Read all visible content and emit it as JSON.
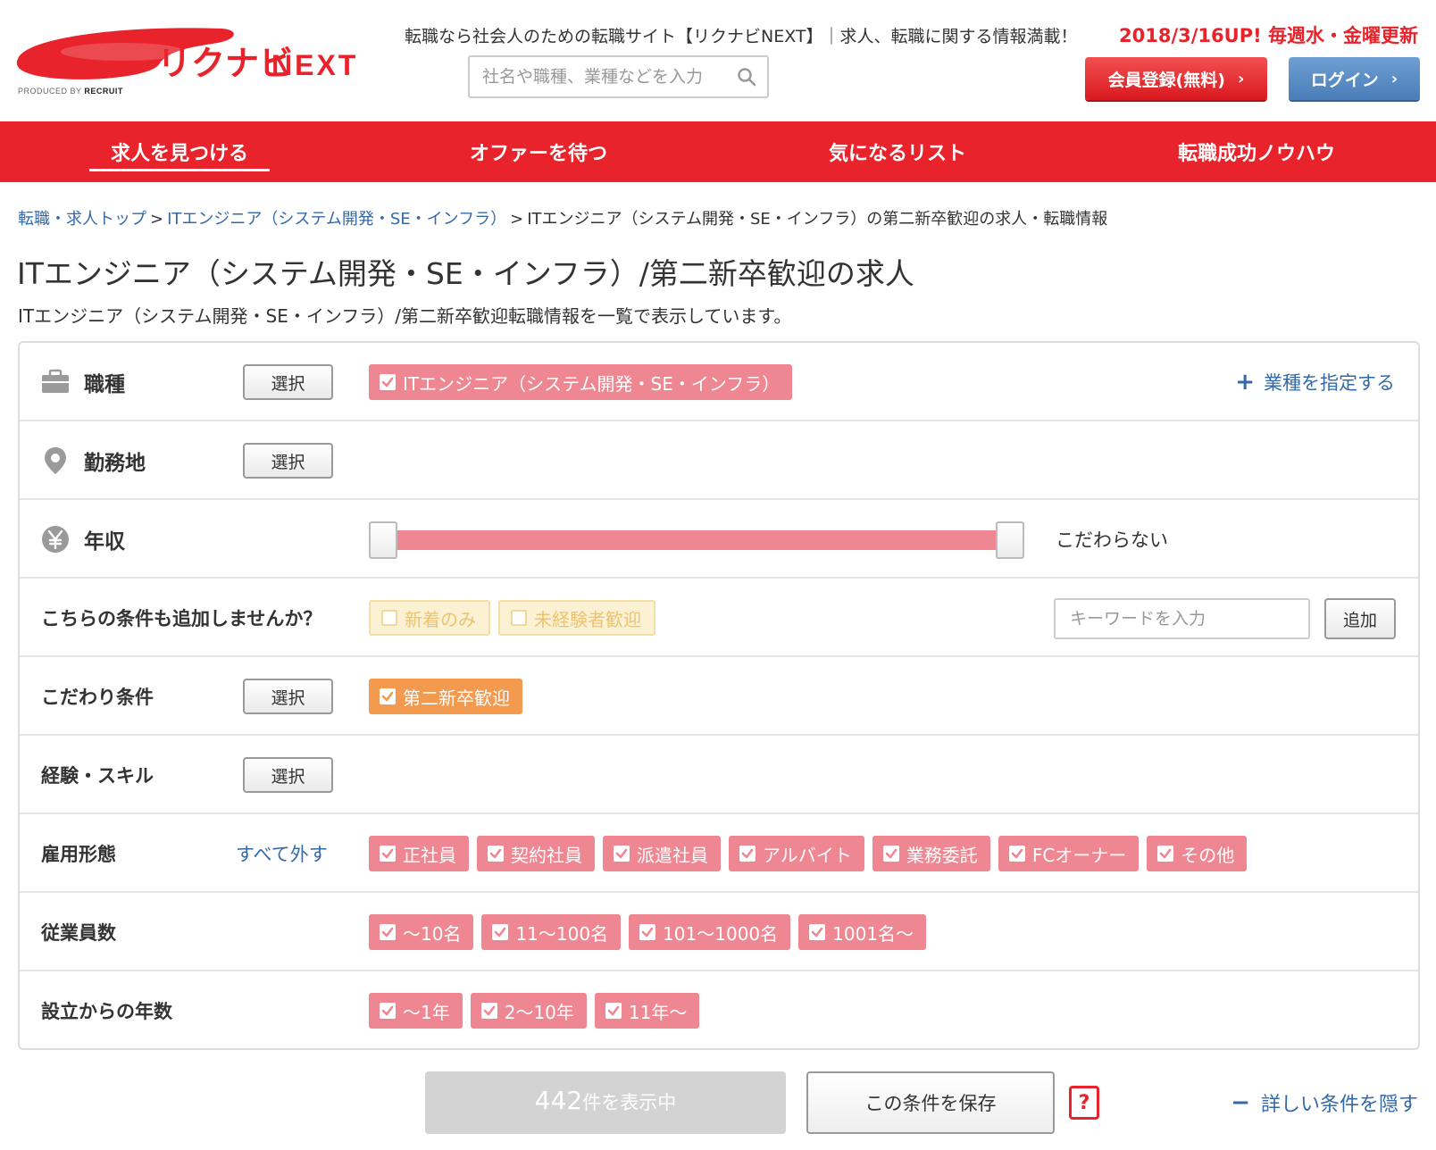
{
  "header": {
    "logo_text": "リクナビNEXT",
    "logo_produced_by": "PRODUCED BY",
    "logo_recruit": "RECRUIT",
    "tagline": "転職なら社会人のための転職サイト【リクナビNEXT】｜求人、転職に関する情報満載！",
    "update_notice": "2018/3/16UP! 毎週水・金曜更新",
    "search_placeholder": "社名や職種、業種などを入力",
    "register_label": "会員登録(無料)",
    "login_label": "ログイン"
  },
  "nav": {
    "items": [
      {
        "label": "求人を見つける",
        "active": true
      },
      {
        "label": "オファーを待つ",
        "active": false
      },
      {
        "label": "気になるリスト",
        "active": false
      },
      {
        "label": "転職成功ノウハウ",
        "active": false
      }
    ]
  },
  "breadcrumb": {
    "items": [
      "転職・求人トップ",
      "ITエンジニア（システム開発・SE・インフラ）"
    ],
    "current": "ITエンジニア（システム開発・SE・インフラ）の第二新卒歓迎の求人・転職情報",
    "separator": ">"
  },
  "page": {
    "title": "ITエンジニア（システム開発・SE・インフラ）/第二新卒歓迎の求人",
    "description": "ITエンジニア（システム開発・SE・インフラ）/第二新卒歓迎転職情報を一覧で表示しています。"
  },
  "filters": {
    "select_label": "選択",
    "occupation": {
      "label": "職種",
      "chips": [
        "ITエンジニア（システム開発・SE・インフラ）"
      ],
      "industry_link": "業種を指定する"
    },
    "location": {
      "label": "勤務地"
    },
    "salary": {
      "label": "年収",
      "value": "こだわらない",
      "range_min_fraction": 0,
      "range_max_fraction": 1
    },
    "suggest": {
      "label": "こちらの条件も追加しませんか？",
      "chips": [
        "新着のみ",
        "未経験者歓迎"
      ],
      "keyword_placeholder": "キーワードを入力",
      "add_label": "追加"
    },
    "preference": {
      "label": "こだわり条件",
      "chips": [
        "第二新卒歓迎"
      ]
    },
    "skill": {
      "label": "経験・スキル"
    },
    "employment": {
      "label": "雇用形態",
      "remove_all": "すべて外す",
      "chips": [
        "正社員",
        "契約社員",
        "派遣社員",
        "アルバイト",
        "業務委託",
        "FCオーナー",
        "その他"
      ]
    },
    "employees": {
      "label": "従業員数",
      "chips": [
        "〜10名",
        "11〜100名",
        "101〜1000名",
        "1001名〜"
      ]
    },
    "years": {
      "label": "設立からの年数",
      "chips": [
        "〜1年",
        "2〜10年",
        "11年〜"
      ]
    }
  },
  "footer_bar": {
    "result_count": "442",
    "result_suffix": "件を表示中",
    "save_label": "この条件を保存",
    "help_label": "?",
    "hide_label": "詳しい条件を隠す"
  },
  "colors": {
    "brand_red": "#e8232b",
    "chip_pink": "#ef8793",
    "chip_orange": "#f49a4f",
    "link_blue": "#3469a8"
  }
}
